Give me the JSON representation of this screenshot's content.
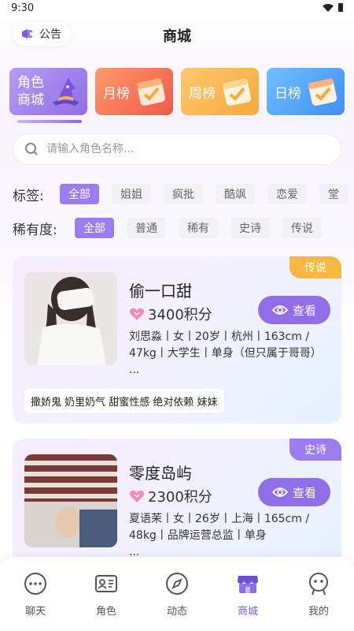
{
  "status": {
    "time": "9:30"
  },
  "header": {
    "notice_label": "公告",
    "title": "商城"
  },
  "rank_tabs": [
    {
      "label": "角色商城",
      "deco": "wizard-hat-icon"
    },
    {
      "label": "月榜",
      "deco": "calendar-check-icon"
    },
    {
      "label": "周榜",
      "deco": "calendar-check-icon"
    },
    {
      "label": "日榜",
      "deco": "calendar-check-icon"
    }
  ],
  "search": {
    "placeholder": "请输入角色名称..."
  },
  "filters": {
    "tags_title": "标签:",
    "tags": [
      "全部",
      "姐姐",
      "疯批",
      "酷飒",
      "恋爱",
      "堂"
    ],
    "rarity_title": "稀有度:",
    "rarity": [
      "全部",
      "普通",
      "稀有",
      "史诗",
      "传说"
    ]
  },
  "cards": [
    {
      "rarity": "传说",
      "name": "偷一口甜",
      "points": "3400积分",
      "view_label": "查看",
      "info": "刘思淼丨女丨20岁丨杭州丨163cm / 47kg丨大学生丨单身（但只属于哥哥）",
      "more": "...",
      "tags": "撒娇鬼 奶里奶气 甜蜜性感 绝对依赖 妹妹"
    },
    {
      "rarity": "史诗",
      "name": "零度岛屿",
      "points": "2300积分",
      "view_label": "查看",
      "info": "夏语茉丨女丨26岁丨上海丨165cm / 48kg丨品牌运营总监丨单身",
      "more": "..."
    }
  ],
  "colors": {
    "accent": "#8f6ee8",
    "legend": "#f5b942",
    "epic": "#9b7df0"
  },
  "tab_bar": [
    {
      "label": "聊天",
      "icon": "chat-bubble-icon"
    },
    {
      "label": "角色",
      "icon": "id-card-icon"
    },
    {
      "label": "动态",
      "icon": "compass-icon"
    },
    {
      "label": "商城",
      "icon": "store-icon"
    },
    {
      "label": "我的",
      "icon": "profile-icon"
    }
  ]
}
